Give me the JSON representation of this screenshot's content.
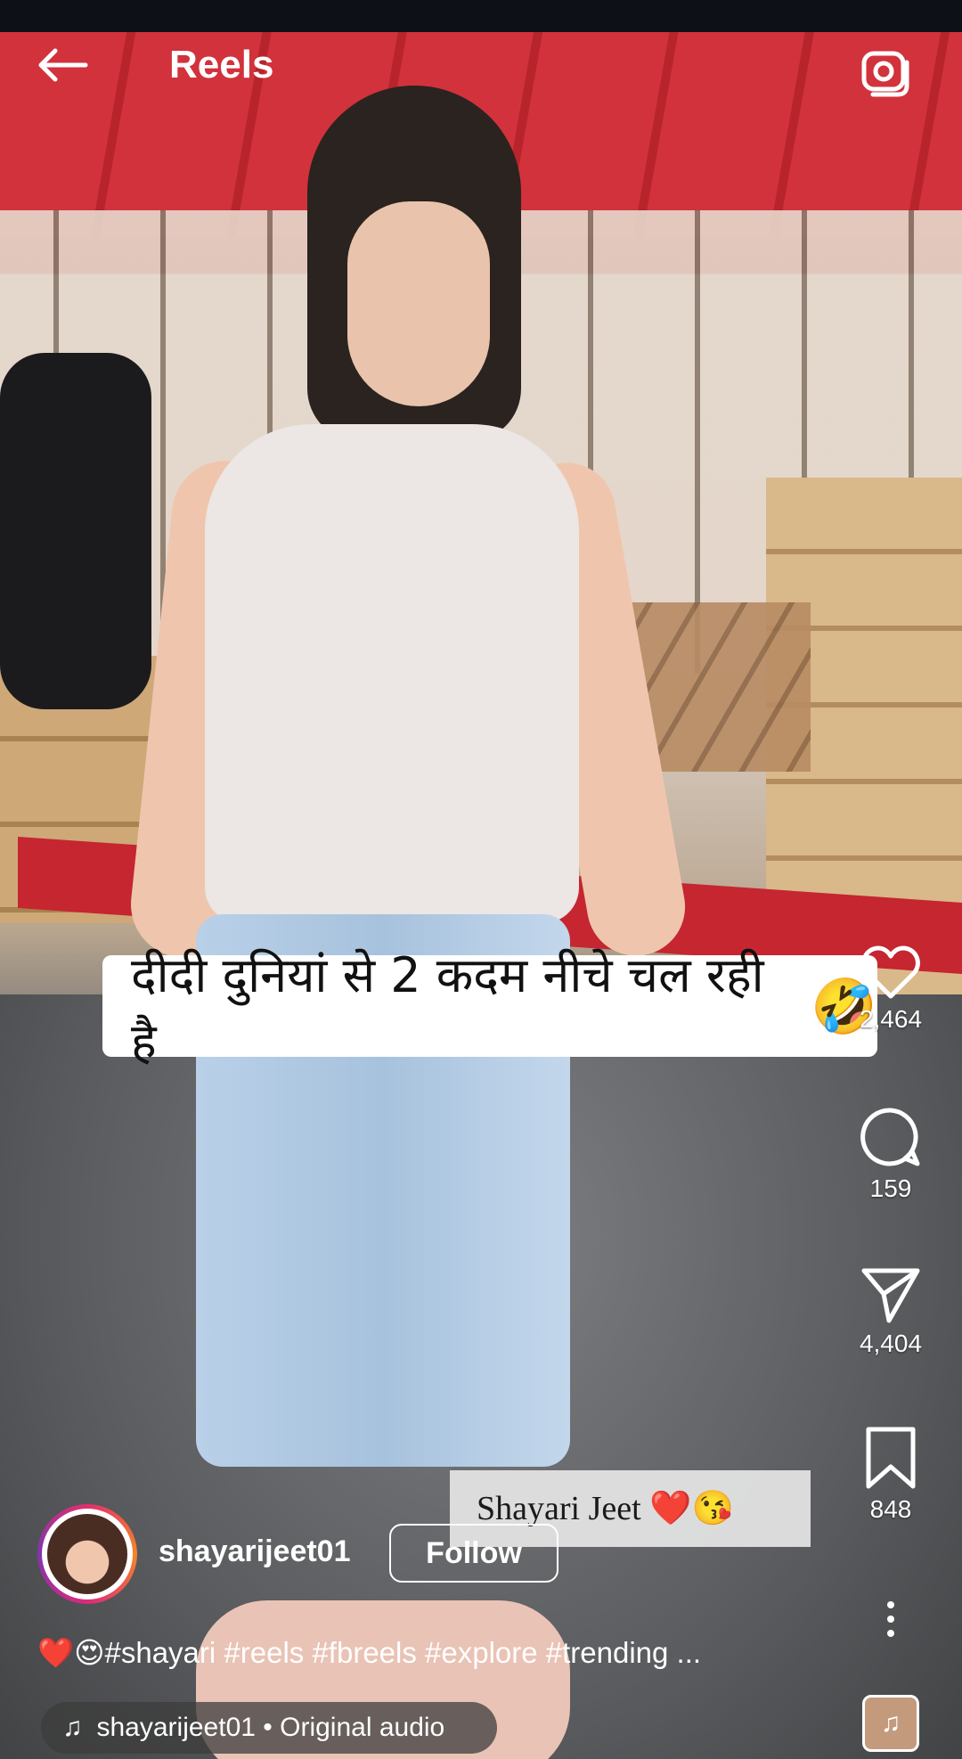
{
  "header": {
    "title": "Reels",
    "back_icon": "arrow-left-icon",
    "camera_icon": "camera-icon"
  },
  "caption": {
    "text": "दीदी दुनियां से 2 कदम नीचे चल रही है",
    "emoji": "🤣"
  },
  "actions": {
    "like": {
      "icon": "heart-icon",
      "count": "2,464"
    },
    "comment": {
      "icon": "comment-icon",
      "count": "159"
    },
    "share": {
      "icon": "send-icon",
      "count": "4,404"
    },
    "save": {
      "icon": "bookmark-icon",
      "count": "848"
    },
    "more": {
      "icon": "more-vertical-icon"
    }
  },
  "watermark": {
    "text": "Shayari Jeet ❤️😘"
  },
  "author": {
    "username": "shayarijeet01",
    "follow_label": "Follow"
  },
  "description": {
    "emoji": "❤️😍",
    "text": "#shayari #reels #fbreels #explore #trending ..."
  },
  "audio": {
    "icon": "music-note-icon",
    "text": "shayarijeet01 • Original audio",
    "thumb_icon": "music-note-icon"
  },
  "colors": {
    "background": "#0d1117",
    "text": "#ffffff",
    "accent_ring": "#e1306c"
  }
}
